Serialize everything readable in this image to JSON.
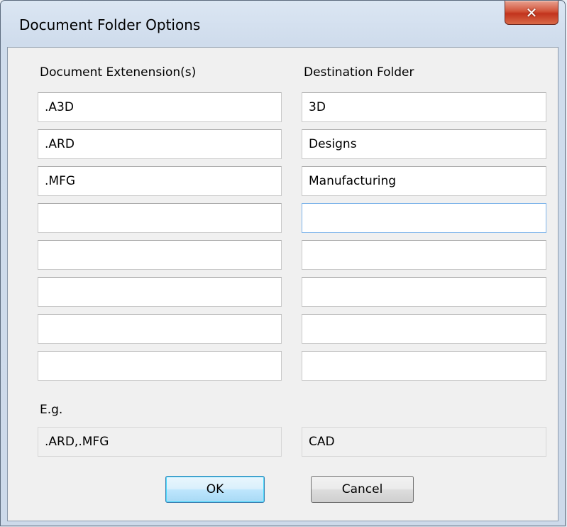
{
  "window": {
    "title": "Document Folder Options",
    "close_glyph": "✕"
  },
  "columns": {
    "extensions_header": "Document Extenension(s)",
    "folder_header": "Destination Folder"
  },
  "rows": [
    {
      "extension": ".A3D",
      "folder": "3D"
    },
    {
      "extension": ".ARD",
      "folder": "Designs"
    },
    {
      "extension": ".MFG",
      "folder": "Manufacturing"
    },
    {
      "extension": "",
      "folder": ""
    },
    {
      "extension": "",
      "folder": ""
    },
    {
      "extension": "",
      "folder": ""
    },
    {
      "extension": "",
      "folder": ""
    },
    {
      "extension": "",
      "folder": ""
    }
  ],
  "example": {
    "label": "E.g.",
    "extension": ".ARD,.MFG",
    "folder": "CAD"
  },
  "buttons": {
    "ok": "OK",
    "cancel": "Cancel"
  },
  "colors": {
    "close_button": "#c7381f",
    "default_button_border": "#3c7fb1",
    "focus_border": "#7eb4ea"
  },
  "icons": {
    "close": "close-icon"
  }
}
